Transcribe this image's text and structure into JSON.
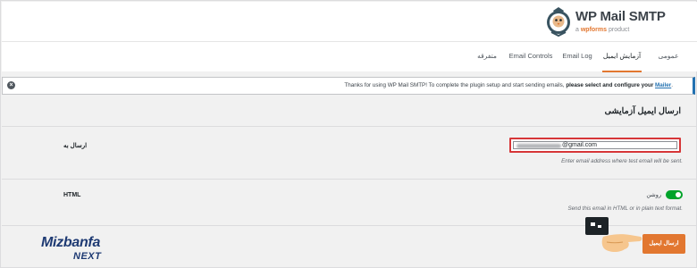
{
  "brand": {
    "title": "WP Mail SMTP",
    "sub_prefix": "a",
    "sub_brand": "wpforms",
    "sub_suffix": "product"
  },
  "tabs": [
    {
      "label": "عمومی",
      "active": false
    },
    {
      "label": "آزمایش ایمیل",
      "active": true
    },
    {
      "label": "Email Log",
      "active": false
    },
    {
      "label": "Email Controls",
      "active": false
    },
    {
      "label": "متفرقه",
      "active": false
    }
  ],
  "notice": {
    "text": "Thanks for using WP Mail SMTP! To complete the plugin setup and start sending emails,",
    "bold": "please select and configure your",
    "link": "Mailer",
    "end": "."
  },
  "section": {
    "title": "ارسال ایمیل آزمایشی"
  },
  "send_to": {
    "label": "ارسال به",
    "value": "@gmail.com",
    "help": "Enter email address where test email will be sent."
  },
  "html": {
    "label": "HTML",
    "toggle_label": "روشن",
    "enabled": true,
    "help": "Send this email in HTML or in plain text format."
  },
  "send_button": {
    "label": "ارسال ایمیل"
  },
  "watermark": {
    "top": "Mizbanfa",
    "bottom": "NEXT"
  },
  "colors": {
    "accent": "#e27730",
    "toggle_on": "#00a32a",
    "highlight": "#d63638",
    "link": "#2271b1"
  }
}
